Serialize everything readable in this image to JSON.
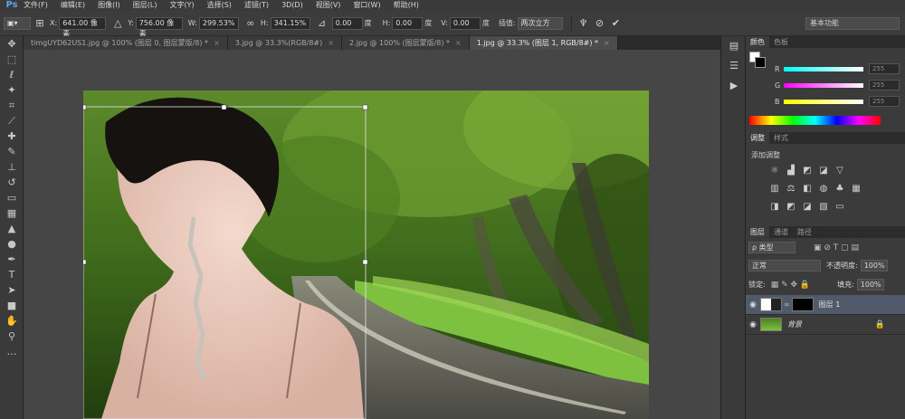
{
  "app": {
    "logo": "Ps"
  },
  "menu": [
    "文件(F)",
    "编辑(E)",
    "图像(I)",
    "图层(L)",
    "文字(Y)",
    "选择(S)",
    "滤镜(T)",
    "3D(D)",
    "视图(V)",
    "窗口(W)",
    "帮助(H)"
  ],
  "options": {
    "x_label": "X:",
    "x_value": "641.00 像素",
    "y_label": "Y:",
    "y_value": "756.00 像素",
    "w_label": "W:",
    "w_value": "299.53%",
    "h_label": "H:",
    "h_value": "341.15%",
    "angle_value": "0.00",
    "angle_unit": "度",
    "hskew_label": "H:",
    "hskew_value": "0.00",
    "hskew_unit": "度",
    "vskew_label": "V:",
    "vskew_value": "0.00",
    "vskew_unit": "度",
    "interp_label": "插值:",
    "interp_value": "两次立方",
    "workspace": "基本功能"
  },
  "tabs": [
    {
      "label": "timgUYD62US1.jpg @ 100% (图层 0, 图层蒙版/8) *",
      "active": false
    },
    {
      "label": "3.jpg @ 33.3%(RGB/8#)",
      "active": false
    },
    {
      "label": "2.jpg @ 100% (图层蒙版/8) *",
      "active": false
    },
    {
      "label": "1.jpg @ 33.3% (图层 1, RGB/8#) *",
      "active": true
    }
  ],
  "color_panel": {
    "tabs": [
      "颜色",
      "色板"
    ],
    "r_label": "R",
    "r_value": "255",
    "g_label": "G",
    "g_value": "255",
    "b_label": "B",
    "b_value": "255",
    "r_level": 1.0,
    "g_level": 1.0,
    "b_level": 1.0
  },
  "adjust_panel": {
    "tabs": [
      "调整",
      "样式"
    ],
    "title": "添加调整"
  },
  "layers_panel": {
    "tabs": [
      "图层",
      "通道",
      "路径"
    ],
    "filter_value": "ρ 类型",
    "blend_mode": "正常",
    "opacity_label": "不透明度:",
    "opacity_value": "100%",
    "lock_label": "锁定:",
    "fill_label": "填充:",
    "fill_value": "100%",
    "layers": [
      {
        "name": "图层 1",
        "active": true
      },
      {
        "name": "背景",
        "active": false
      }
    ]
  },
  "colors": {
    "accent": "#5fa3e8",
    "panel_bg": "#3b3b3b",
    "canvas_bg": "#464646"
  }
}
